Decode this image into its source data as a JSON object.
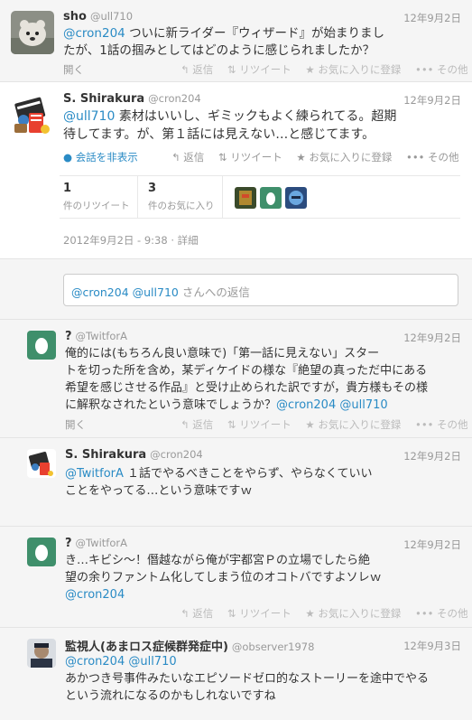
{
  "actions": {
    "open": "開く",
    "reply": "返信",
    "retweet": "リツイート",
    "favorite": "お気に入りに登録",
    "more": "その他",
    "hide_conversation": "会話を非表示"
  },
  "tweets": [
    {
      "name": "sho",
      "handle": "@ull710",
      "date": "12年9月2日",
      "mention": "@cron204",
      "lines": [
        "ついに新ライダー『ウィザード』が始まりまし",
        "たが、1話の掴みとしてはどのように感じられましたか？"
      ]
    },
    {
      "name": "S. Shirakura",
      "handle": "@cron204",
      "date": "12年9月2日",
      "mention": "@ull710",
      "lines": [
        "素材はいいし、ギミックもよく練られてる。超期",
        "待してます。が、第１話には見えない…と感じてます。"
      ],
      "retweets_count": "1",
      "retweets_label": "件のリツイート",
      "favorites_count": "3",
      "favorites_label": "件のお気に入り",
      "timestamp": "2012年9月2日 - 9:38",
      "details": "詳細"
    },
    {
      "name": "?",
      "handle": "@TwitforA",
      "date": "12年9月2日",
      "lines": [
        "俺的には(もちろん良い意味で)「第一話に見えない」スター",
        "トを切った所を含め，某ディケイドの様な『絶望の真っただ中にある",
        "希望を感じさせる作品』と受け止められた訳ですが，貴方様もその様",
        "に解釈なされたという意味でしょうか？"
      ],
      "trailing_mentions": "@cron204 @ull710"
    },
    {
      "name": "S. Shirakura",
      "handle": "@cron204",
      "date": "12年9月2日",
      "mention": "@TwitforA",
      "lines": [
        "１話でやるべきことをやらず、やらなくていい",
        "ことをやってる…という意味ですｗ"
      ]
    },
    {
      "name": "?",
      "handle": "@TwitforA",
      "date": "12年9月2日",
      "lines": [
        "き…キビシ～！僭越ながら俺が宇都宮Ｐの立場でしたら絶",
        "望の余りファントム化してしまう位のオコトバですよソレｗ"
      ],
      "trailing_mentions": "@cron204"
    },
    {
      "name": "監視人(あまロス症候群発症中)",
      "handle": "@observer1978",
      "date": "12年9月3日",
      "mention": "@cron204 @ull710",
      "lines": [
        "あかつき号事件みたいなエピソードゼロ的なストーリーを途中でやる",
        "という流れになるのかもしれないですね"
      ]
    }
  ],
  "reply_box": {
    "mentions": "@cron204 @ull710",
    "placeholder": "さんへの返信"
  }
}
